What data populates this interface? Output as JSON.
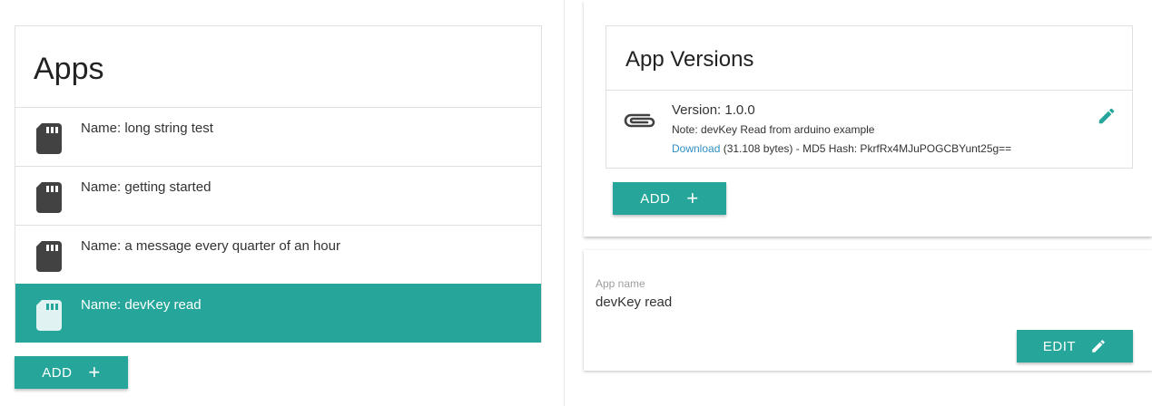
{
  "apps": {
    "title": "Apps",
    "items": [
      {
        "label": "Name: long string test",
        "selected": false
      },
      {
        "label": "Name: getting started",
        "selected": false
      },
      {
        "label": "Name: a message every quarter of an hour",
        "selected": false
      },
      {
        "label": "Name: devKey read",
        "selected": true
      }
    ],
    "add_label": "ADD",
    "add_icon": "+"
  },
  "versions": {
    "title": "App Versions",
    "items": [
      {
        "version": "Version: 1.0.0",
        "note": "Note: devKey Read from arduino example",
        "download_label": "Download",
        "details": " (31.108 bytes) - MD5 Hash: PkrfRx4MJuPOGCBYunt25g=="
      }
    ],
    "add_label": "ADD",
    "add_icon": "+"
  },
  "app_details": {
    "name_label": "App name",
    "name_value": "devKey read",
    "edit_label": "EDIT"
  },
  "icons": {
    "app_icon": "sd-card-icon",
    "version_icon": "paperclip-icon",
    "edit_icon": "pencil-icon"
  },
  "colors": {
    "accent": "#26a69a",
    "link": "#2f8fc3",
    "icon_dark": "#424242"
  }
}
